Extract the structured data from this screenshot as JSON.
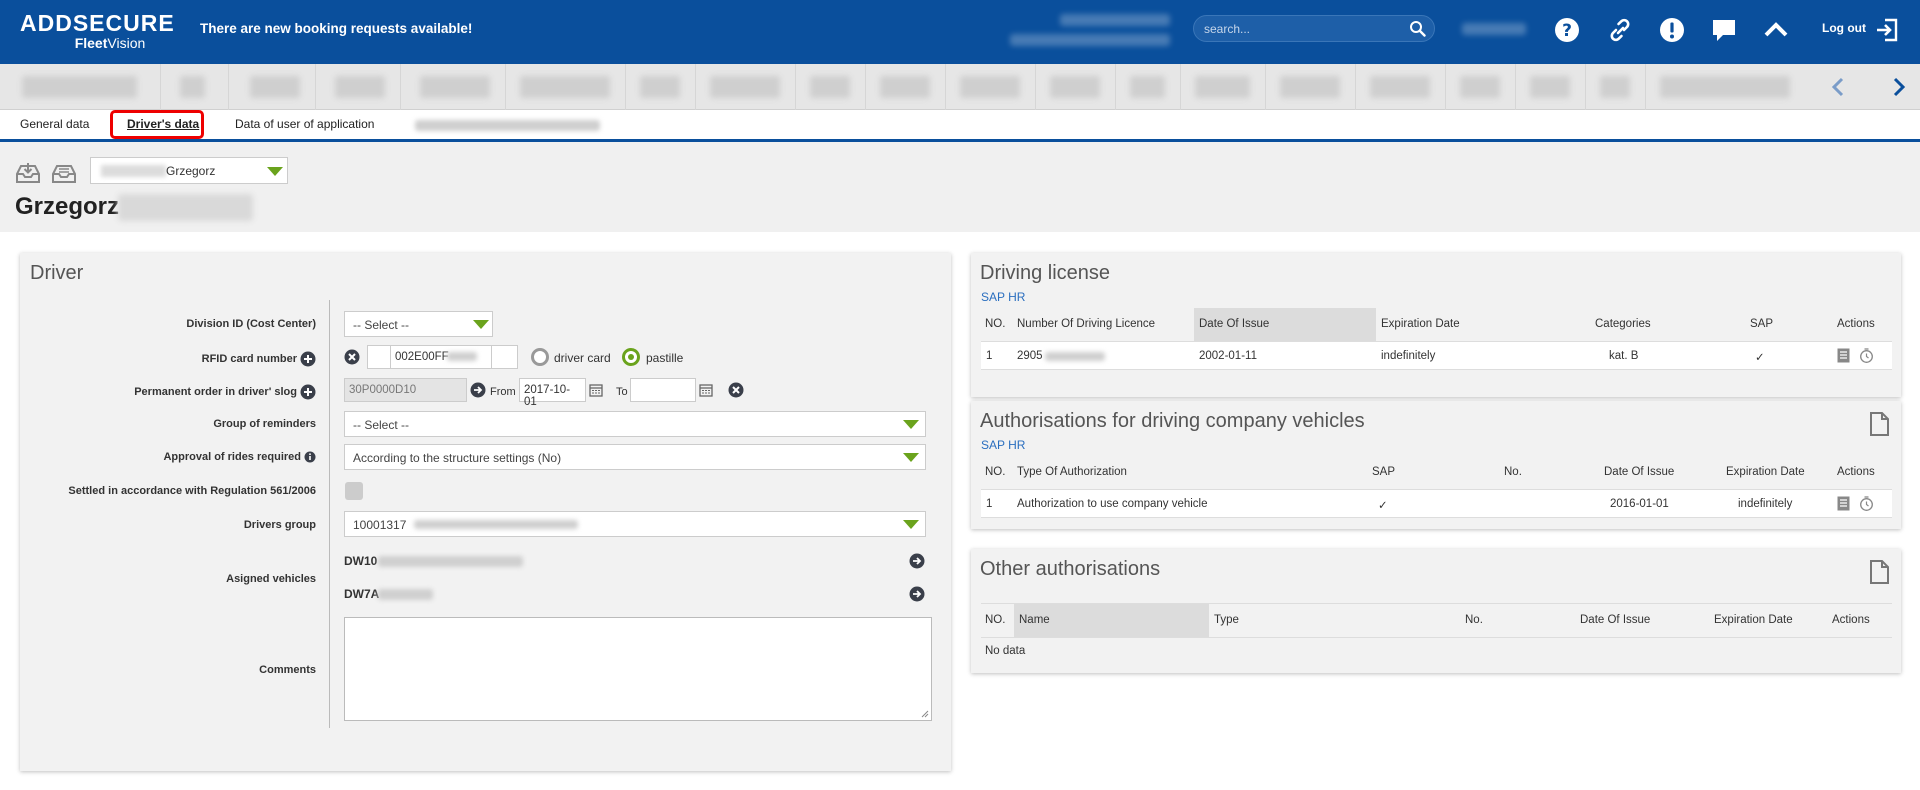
{
  "header": {
    "brand_top": "ADDSECURE",
    "brand_bottom_bold": "Fleet",
    "brand_bottom_rest": "Vision",
    "notice": "There are new booking requests available!",
    "search_placeholder": "search...",
    "logout": "Log out",
    "icons": [
      "help-icon",
      "link-icon",
      "alert-icon",
      "chat-icon",
      "collapse-up-icon",
      "logout-icon"
    ],
    "accent": "#0a4f9c"
  },
  "tabs": [
    {
      "label": "General data"
    },
    {
      "label": "Driver's data",
      "active": true
    },
    {
      "label": "Data of user of application"
    }
  ],
  "driver_header": {
    "selected": "Grzegorz",
    "name": "Grzegorz"
  },
  "driver_panel": {
    "title": "Driver",
    "fields": {
      "division_label": "Division ID (Cost Center)",
      "division_value": "-- Select --",
      "rfid_label": "RFID card number",
      "rfid_value": "002E00FF",
      "rfid_option_card": "driver card",
      "rfid_option_pastille": "pastille",
      "rfid_selected": "pastille",
      "order_label": "Permanent order in driver' slog",
      "order_value": "30P0000D10",
      "from_label": "From",
      "from_value": "2017-10-01",
      "to_label": "To",
      "to_value": "",
      "reminders_label": "Group of reminders",
      "reminders_value": "-- Select --",
      "approval_label": "Approval of rides required",
      "approval_value": "According to the structure settings (No)",
      "settled_label": "Settled in accordance with Regulation 561/2006",
      "drivers_group_label": "Drivers group",
      "drivers_group_value": "10001317",
      "vehicles_label": "Asigned vehicles",
      "vehicle_1": "DW10",
      "vehicle_2": "DW7A",
      "comments_label": "Comments"
    }
  },
  "license_panel": {
    "title": "Driving license",
    "link": "SAP HR",
    "columns": [
      "NO.",
      "Number Of Driving Licence",
      "Date Of Issue",
      "Expiration Date",
      "Categories",
      "SAP",
      "Actions"
    ],
    "rows": [
      {
        "no": "1",
        "number": "2905",
        "issue": "2002-01-11",
        "expiration": "indefinitely",
        "categories": "kat. B",
        "sap": "✓"
      }
    ]
  },
  "auth_panel": {
    "title": "Authorisations for driving company vehicles",
    "link": "SAP HR",
    "columns": [
      "NO.",
      "Type Of Authorization",
      "SAP",
      "No.",
      "Date Of Issue",
      "Expiration Date",
      "Actions"
    ],
    "rows": [
      {
        "no": "1",
        "type": "Authorization to use company vehicle",
        "sap": "✓",
        "num": "",
        "issue": "2016-01-01",
        "expiration": "indefinitely"
      }
    ]
  },
  "other_panel": {
    "title": "Other authorisations",
    "columns": [
      "NO.",
      "Name",
      "Type",
      "No.",
      "Date Of Issue",
      "Expiration Date",
      "Actions"
    ],
    "empty": "No data"
  }
}
